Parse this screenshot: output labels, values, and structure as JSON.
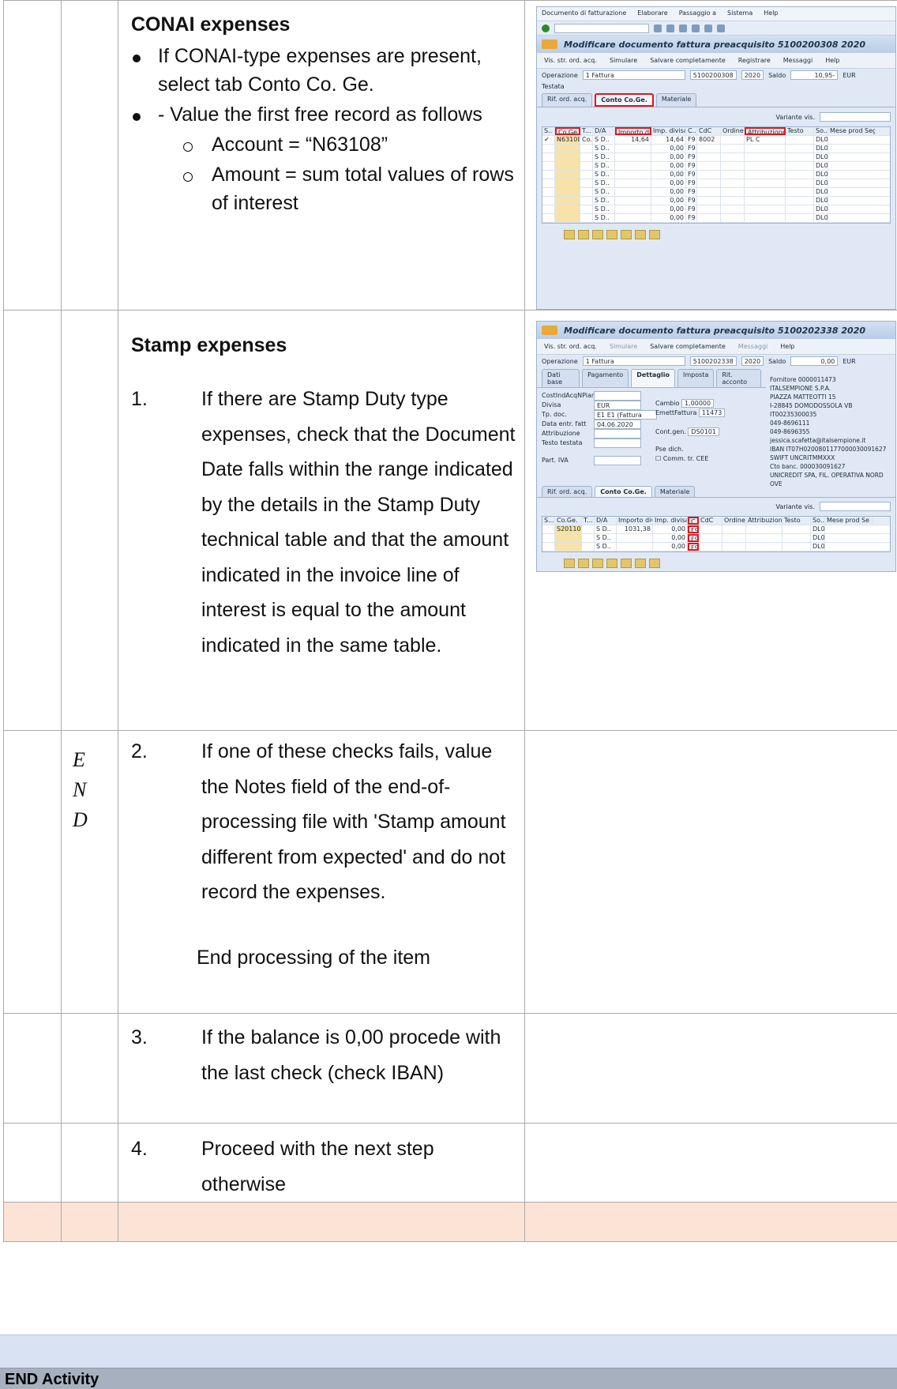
{
  "conai": {
    "heading": "CONAI expenses",
    "bullet1": "If CONAI-type expenses are present, select tab Conto Co. Ge.",
    "bullet2": "- Value the first free record as follows",
    "sub1": "Account = “N63108”",
    "sub2": "Amount = sum total values of rows of interest"
  },
  "stamp": {
    "heading": "Stamp expenses",
    "step1_num": "1.",
    "step1_text": "If there are Stamp Duty type expenses, check that the Document Date falls within the range indicated by the details in the Stamp Duty technical table and that the amount indicated in the invoice line of interest is equal to the amount indicated in the same table.",
    "end_letters": [
      "E",
      "N",
      "D"
    ],
    "step2_num": "2.",
    "step2_text": "If one of these checks fails, value the Notes field of the end-of-processing file with 'Stamp amount different from expected' and do not record the expenses.",
    "step2_end": "End processing of the item",
    "step3_num": "3.",
    "step3_text": "If the balance is 0,00 procede with the last check (check IBAN)",
    "step4_num": "4.",
    "step4_text": "Proceed with the next step otherwise"
  },
  "footer": {
    "end_activity": "END Activity"
  },
  "colors": {
    "peach_row": "#fbe4d5",
    "blue_bar": "#d9e2f3",
    "grey_bar": "#a6b0be",
    "highlight_box": "#e0161b"
  },
  "sap1": {
    "menu": [
      "Documento di fatturazione",
      "Elaborare",
      "Passaggio a",
      "Sistema",
      "Help"
    ],
    "title": "Modificare documento fattura preacquisito 5100200308 2020",
    "app_buttons": [
      "Vis. str. ord. acq.",
      "Simulare",
      "Salvare completamente",
      "Registrare",
      "Messaggi",
      "Help"
    ],
    "operazione_label": "Operazione",
    "operazione_value": "1 Fattura",
    "doc_number": "5100200308",
    "year": "2020",
    "saldo_label": "Saldo",
    "saldo_value": "10,95-",
    "currency": "EUR",
    "testata": "Testata",
    "tabs": [
      "Rif. ord. acq.",
      "Conto Co.Ge.",
      "Materiale"
    ],
    "variante_label": "Variante vis.",
    "columns": [
      "S..",
      "Co.Ge.",
      "T...",
      "D/A",
      "Importo divis...",
      "Imp. divisa...",
      "C...",
      "CdC",
      "Ordine",
      "Attribuzione",
      "Testo",
      "So...",
      "Mese prod...",
      "Seg"
    ],
    "first_row": [
      "N63108",
      "Co..",
      "S D..",
      "14,64",
      "14,64",
      "F9",
      "8002",
      "PL C",
      "",
      "DL01"
    ],
    "empty_rows": [
      "0,00",
      "0,00",
      "0,00",
      "0,00",
      "0,00",
      "0,00",
      "0,00",
      "0,00",
      "0,00"
    ],
    "row_code": "F9",
    "row_da": "S D..",
    "row_so": "DL01"
  },
  "sap2": {
    "title": "Modificare documento fattura preacquisito 5100202338 2020",
    "app_buttons": [
      "Vis. str. ord. acq.",
      "Simulare",
      "Salvare completamente",
      "Messaggi",
      "Help"
    ],
    "operazione_label": "Operazione",
    "operazione_value": "1 Fattura",
    "doc_number": "5100202338",
    "year": "2020",
    "saldo_label": "Saldo",
    "saldo_value": "0,00",
    "currency": "EUR",
    "tabs_top": [
      "Dati base",
      "Pagamento",
      "Dettaglio",
      "Imposta",
      "Rit. acconto"
    ],
    "fields": [
      {
        "label": "CostIndAcqNPian",
        "value": ""
      },
      {
        "label": "Divisa",
        "value": "EUR"
      },
      {
        "label": "Tp. doc.",
        "value": "E1 E1 (Fattura acq. ele"
      },
      {
        "label": "Data entr. fatt",
        "value": "04.06.2020"
      },
      {
        "label": "Attribuzione",
        "value": ""
      },
      {
        "label": "Testo testata",
        "value": ""
      },
      {
        "label": "Part. IVA",
        "value": ""
      }
    ],
    "cambio_label": "Cambio",
    "cambio_value": "1,00000",
    "emittfattura_label": "EmettFattura",
    "emittfattura_value": "11473",
    "contgen_label": "Cont.gen.",
    "contgen_value": "DS0101",
    "psedich_label": "Pse dich.",
    "comm_label": "Comm. tr. CEE",
    "vendor": [
      "Fornitore 0000011473",
      "ITALSEMPIONE S.P.A.",
      "PIAZZA MATTEOTTI 15",
      "I-28845 DOMODOSSOLA VB",
      "IT00235300035",
      "049-8696111",
      "049-8696355",
      "jessica.scafetta@italsempione.it",
      "IBAN    IT07H0200801177000030091627",
      "SWIFT   UNCRITMMXXX",
      "Cto banc.  000030091627",
      "UNICREDIT SPA, FIL. OPERATIVA NORD OVE"
    ],
    "tabs": [
      "Rif. ord. acq.",
      "Conto Co.Ge.",
      "Materiale"
    ],
    "variante_label": "Variante vis.",
    "columns": [
      "S...",
      "Co.Ge.",
      "T...",
      "D/A",
      "Importo divis...",
      "Imp. divisa...",
      "C...",
      "CdC",
      "Ordine",
      "Attribuzione",
      "Testo",
      "So...",
      "Mese prod...",
      "Se"
    ],
    "first_row": [
      "S20110",
      "S D..",
      "1031,38",
      "0,00",
      "F9",
      "DL01"
    ],
    "empty_rows": [
      "0,00",
      "0,00"
    ],
    "row_code": "F9",
    "row_da": "S D..",
    "row_so": "DL01"
  }
}
